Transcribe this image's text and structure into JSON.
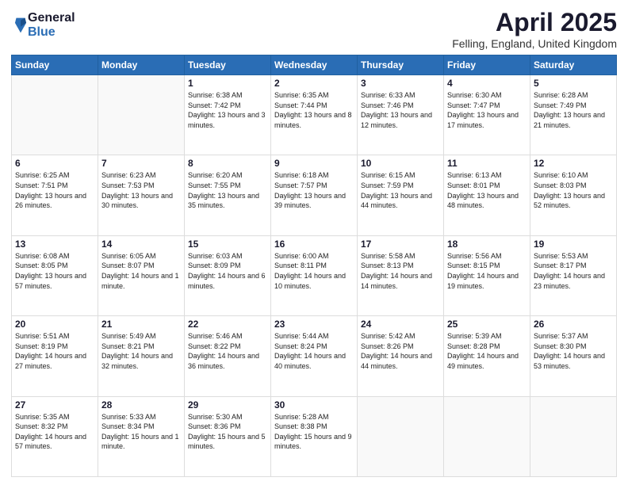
{
  "logo": {
    "general": "General",
    "blue": "Blue"
  },
  "header": {
    "month": "April 2025",
    "location": "Felling, England, United Kingdom"
  },
  "weekdays": [
    "Sunday",
    "Monday",
    "Tuesday",
    "Wednesday",
    "Thursday",
    "Friday",
    "Saturday"
  ],
  "weeks": [
    [
      {
        "day": "",
        "info": ""
      },
      {
        "day": "",
        "info": ""
      },
      {
        "day": "1",
        "info": "Sunrise: 6:38 AM\nSunset: 7:42 PM\nDaylight: 13 hours and 3 minutes."
      },
      {
        "day": "2",
        "info": "Sunrise: 6:35 AM\nSunset: 7:44 PM\nDaylight: 13 hours and 8 minutes."
      },
      {
        "day": "3",
        "info": "Sunrise: 6:33 AM\nSunset: 7:46 PM\nDaylight: 13 hours and 12 minutes."
      },
      {
        "day": "4",
        "info": "Sunrise: 6:30 AM\nSunset: 7:47 PM\nDaylight: 13 hours and 17 minutes."
      },
      {
        "day": "5",
        "info": "Sunrise: 6:28 AM\nSunset: 7:49 PM\nDaylight: 13 hours and 21 minutes."
      }
    ],
    [
      {
        "day": "6",
        "info": "Sunrise: 6:25 AM\nSunset: 7:51 PM\nDaylight: 13 hours and 26 minutes."
      },
      {
        "day": "7",
        "info": "Sunrise: 6:23 AM\nSunset: 7:53 PM\nDaylight: 13 hours and 30 minutes."
      },
      {
        "day": "8",
        "info": "Sunrise: 6:20 AM\nSunset: 7:55 PM\nDaylight: 13 hours and 35 minutes."
      },
      {
        "day": "9",
        "info": "Sunrise: 6:18 AM\nSunset: 7:57 PM\nDaylight: 13 hours and 39 minutes."
      },
      {
        "day": "10",
        "info": "Sunrise: 6:15 AM\nSunset: 7:59 PM\nDaylight: 13 hours and 44 minutes."
      },
      {
        "day": "11",
        "info": "Sunrise: 6:13 AM\nSunset: 8:01 PM\nDaylight: 13 hours and 48 minutes."
      },
      {
        "day": "12",
        "info": "Sunrise: 6:10 AM\nSunset: 8:03 PM\nDaylight: 13 hours and 52 minutes."
      }
    ],
    [
      {
        "day": "13",
        "info": "Sunrise: 6:08 AM\nSunset: 8:05 PM\nDaylight: 13 hours and 57 minutes."
      },
      {
        "day": "14",
        "info": "Sunrise: 6:05 AM\nSunset: 8:07 PM\nDaylight: 14 hours and 1 minute."
      },
      {
        "day": "15",
        "info": "Sunrise: 6:03 AM\nSunset: 8:09 PM\nDaylight: 14 hours and 6 minutes."
      },
      {
        "day": "16",
        "info": "Sunrise: 6:00 AM\nSunset: 8:11 PM\nDaylight: 14 hours and 10 minutes."
      },
      {
        "day": "17",
        "info": "Sunrise: 5:58 AM\nSunset: 8:13 PM\nDaylight: 14 hours and 14 minutes."
      },
      {
        "day": "18",
        "info": "Sunrise: 5:56 AM\nSunset: 8:15 PM\nDaylight: 14 hours and 19 minutes."
      },
      {
        "day": "19",
        "info": "Sunrise: 5:53 AM\nSunset: 8:17 PM\nDaylight: 14 hours and 23 minutes."
      }
    ],
    [
      {
        "day": "20",
        "info": "Sunrise: 5:51 AM\nSunset: 8:19 PM\nDaylight: 14 hours and 27 minutes."
      },
      {
        "day": "21",
        "info": "Sunrise: 5:49 AM\nSunset: 8:21 PM\nDaylight: 14 hours and 32 minutes."
      },
      {
        "day": "22",
        "info": "Sunrise: 5:46 AM\nSunset: 8:22 PM\nDaylight: 14 hours and 36 minutes."
      },
      {
        "day": "23",
        "info": "Sunrise: 5:44 AM\nSunset: 8:24 PM\nDaylight: 14 hours and 40 minutes."
      },
      {
        "day": "24",
        "info": "Sunrise: 5:42 AM\nSunset: 8:26 PM\nDaylight: 14 hours and 44 minutes."
      },
      {
        "day": "25",
        "info": "Sunrise: 5:39 AM\nSunset: 8:28 PM\nDaylight: 14 hours and 49 minutes."
      },
      {
        "day": "26",
        "info": "Sunrise: 5:37 AM\nSunset: 8:30 PM\nDaylight: 14 hours and 53 minutes."
      }
    ],
    [
      {
        "day": "27",
        "info": "Sunrise: 5:35 AM\nSunset: 8:32 PM\nDaylight: 14 hours and 57 minutes."
      },
      {
        "day": "28",
        "info": "Sunrise: 5:33 AM\nSunset: 8:34 PM\nDaylight: 15 hours and 1 minute."
      },
      {
        "day": "29",
        "info": "Sunrise: 5:30 AM\nSunset: 8:36 PM\nDaylight: 15 hours and 5 minutes."
      },
      {
        "day": "30",
        "info": "Sunrise: 5:28 AM\nSunset: 8:38 PM\nDaylight: 15 hours and 9 minutes."
      },
      {
        "day": "",
        "info": ""
      },
      {
        "day": "",
        "info": ""
      },
      {
        "day": "",
        "info": ""
      }
    ]
  ]
}
